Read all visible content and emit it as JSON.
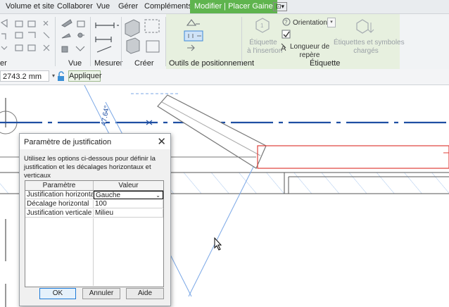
{
  "tabs": [
    "Volume et site",
    "Collaborer",
    "Vue",
    "Gérer",
    "Compléments",
    "Modifier | Placer Gaine"
  ],
  "ribbon": {
    "groups": {
      "partial_er": "er",
      "vue": "Vue",
      "mesurer": "Mesurer",
      "creer": "Créer",
      "outils": "Outils de positionnement",
      "etiquette": "Étiquette"
    },
    "tools": {
      "etiquette_insertion": "Étiquette\nà l'insertion",
      "orientation": "Orientation",
      "longueur_repere": "Longueur de\nrepère",
      "etiquettes_symboles": "Étiquettes et symboles\nchargés"
    }
  },
  "options_bar": {
    "value": "2743.2 mm",
    "apply_label": "Appliquer"
  },
  "canvas": {
    "dimension_text": "47.64°"
  },
  "dialog": {
    "title": "Paramètre de justification",
    "description": "Utilisez les options ci-dessous pour définir la justification et les décalages horizontaux et verticaux",
    "headers": [
      "Paramètre",
      "Valeur"
    ],
    "rows": [
      {
        "param": "Justification horizontale",
        "value": "Gauche"
      },
      {
        "param": "Décalage horizontal",
        "value": "100"
      },
      {
        "param": "Justification verticale",
        "value": "Milieu"
      }
    ],
    "buttons": {
      "ok": "OK",
      "cancel": "Annuler",
      "help": "Aide"
    }
  },
  "colors": {
    "active_tab": "#5fb44e",
    "selection_red": "#e0403a",
    "centerline_blue": "#1f4fa3",
    "guide_blue": "#7aa7e6"
  }
}
